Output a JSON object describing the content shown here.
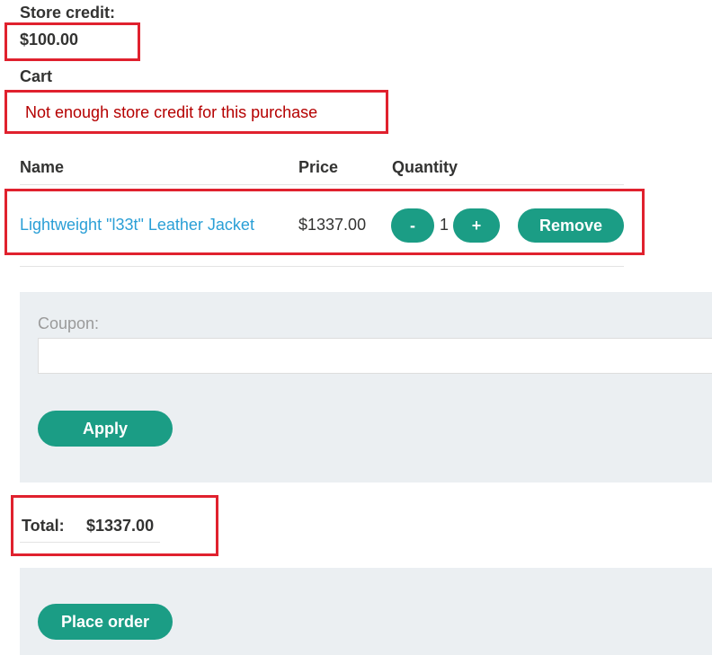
{
  "store_credit": {
    "label": "Store credit:",
    "value": "$100.00"
  },
  "cart": {
    "title": "Cart",
    "error": "Not enough store credit for this purchase",
    "columns": {
      "name": "Name",
      "price": "Price",
      "quantity": "Quantity"
    },
    "items": [
      {
        "name": "Lightweight \"l33t\" Leather Jacket",
        "price": "$1337.00",
        "quantity": "1",
        "decrement_label": "-",
        "increment_label": "+",
        "remove_label": "Remove"
      }
    ]
  },
  "coupon": {
    "label": "Coupon:",
    "value": "",
    "apply_label": "Apply"
  },
  "total": {
    "label": "Total:",
    "value": "$1337.00"
  },
  "order": {
    "place_label": "Place order"
  },
  "colors": {
    "accent": "#1b9d85",
    "link": "#2a9fd6",
    "error": "#b50000",
    "highlight_box": "#e0212e",
    "panel": "#ebeff2"
  }
}
